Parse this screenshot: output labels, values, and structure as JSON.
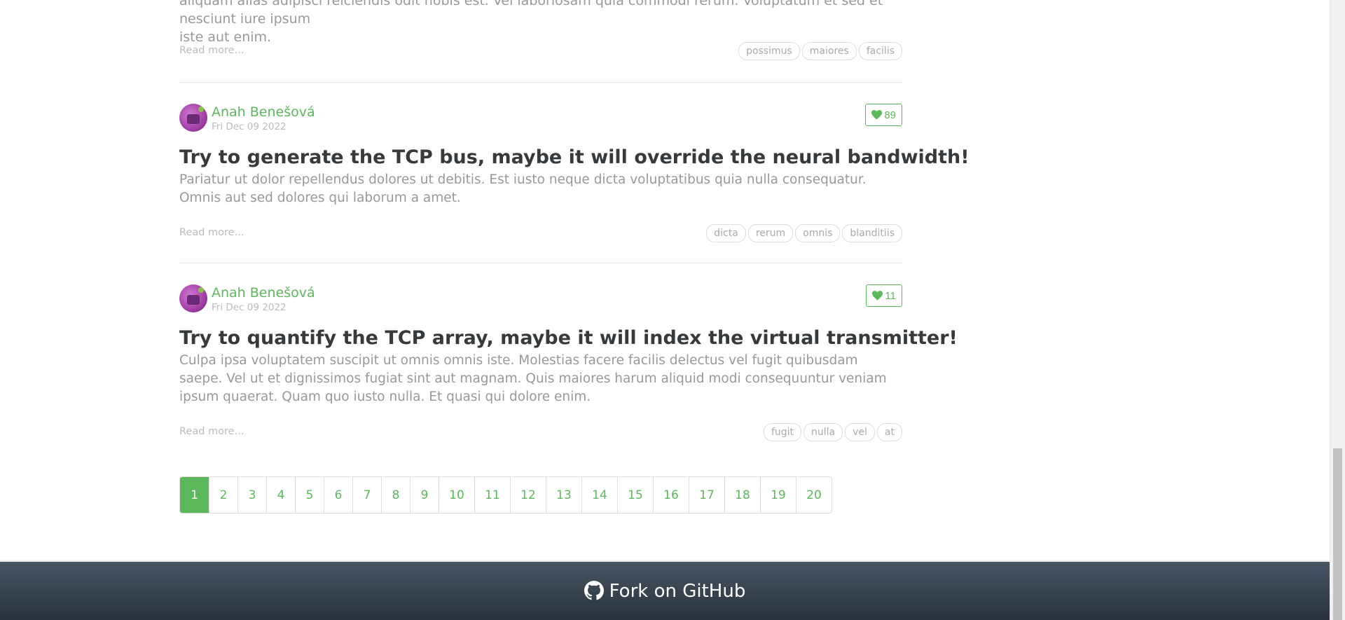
{
  "partial_article": {
    "text_line_1": "aliquam alias adipisci reiciendis odit nobis est. Vel laboriosam quia commodi rerum. Voluptatum et sed et nesciunt iure ipsum",
    "text_line_2": "iste aut enim.",
    "read_more": "Read more...",
    "tags": [
      "possimus",
      "maiores",
      "facilis"
    ]
  },
  "articles": [
    {
      "author": "Anah Benešová",
      "date": "Fri Dec 09 2022",
      "likes": "89",
      "title": "Try to generate the TCP bus, maybe it will override the neural bandwidth!",
      "description": "Pariatur ut dolor repellendus dolores ut debitis. Est iusto neque dicta voluptatibus quia nulla consequatur. Omnis aut sed dolores qui laborum a amet.",
      "read_more": "Read more...",
      "tags": [
        "dicta",
        "rerum",
        "omnis",
        "blanditiis"
      ]
    },
    {
      "author": "Anah Benešová",
      "date": "Fri Dec 09 2022",
      "likes": "11",
      "title": "Try to quantify the TCP array, maybe it will index the virtual transmitter!",
      "description": "Culpa ipsa voluptatem suscipit ut omnis omnis iste. Molestias facere facilis delectus vel fugit quibusdam saepe. Vel ut et dignissimos fugiat sint aut magnam. Quis maiores harum aliquid modi consequuntur veniam ipsum quaerat. Quam quo iusto nulla. Et quasi qui dolore enim.",
      "read_more": "Read more...",
      "tags": [
        "fugit",
        "nulla",
        "vel",
        "at"
      ]
    }
  ],
  "pagination": {
    "pages": [
      "1",
      "2",
      "3",
      "4",
      "5",
      "6",
      "7",
      "8",
      "9",
      "10",
      "11",
      "12",
      "13",
      "14",
      "15",
      "16",
      "17",
      "18",
      "19",
      "20"
    ],
    "active": "1"
  },
  "footer": {
    "link_text": "Fork on GitHub"
  },
  "colors": {
    "accent": "#5cb85c",
    "footer_top": "#485563",
    "footer_bottom": "#29323c"
  }
}
